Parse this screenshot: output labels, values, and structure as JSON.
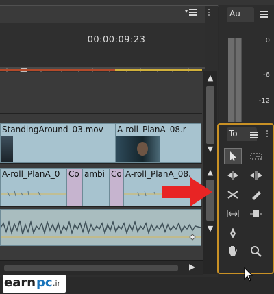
{
  "timeline": {
    "timecode": "00:00:09:23",
    "clips": {
      "video_a": {
        "label": "StandingAround_03.mov"
      },
      "video_b": {
        "label": "A-roll_PlanA_08.r"
      },
      "audio_a": {
        "label": "A-roll_PlanA_0"
      },
      "audio_a_fx": {
        "label": "Co"
      },
      "audio_b": {
        "label": "ambi"
      },
      "audio_b_fx": {
        "label": "Co"
      },
      "audio_c": {
        "label": "A-roll_PlanA_08."
      }
    }
  },
  "audio_panel": {
    "tab_label": "Au",
    "db_labels": [
      "0",
      "-6",
      "-12"
    ]
  },
  "tools_panel": {
    "tab_label": "To",
    "tools": [
      {
        "name": "selection-tool",
        "icon": "arrow-pointer-icon"
      },
      {
        "name": "track-select-tool",
        "icon": "dashed-arrow-icon"
      },
      {
        "name": "ripple-edit-tool",
        "icon": "ripple-edit-icon"
      },
      {
        "name": "rolling-edit-tool",
        "icon": "rolling-edit-icon"
      },
      {
        "name": "rate-stretch-tool",
        "icon": "rate-stretch-icon"
      },
      {
        "name": "razor-tool",
        "icon": "razor-icon"
      },
      {
        "name": "slip-tool",
        "icon": "slip-icon"
      },
      {
        "name": "slide-tool",
        "icon": "slide-icon"
      },
      {
        "name": "pen-tool",
        "icon": "pen-icon"
      },
      {
        "name": "hand-tool",
        "icon": "hand-icon"
      },
      {
        "name": "zoom-tool",
        "icon": "magnifier-icon"
      }
    ]
  },
  "watermark": {
    "text_main": "earn",
    "text_mid": "pc",
    "text_suffix": ".ir"
  },
  "colors": {
    "accent_highlight": "#c99125",
    "clip_blue": "#a7c3cf",
    "work_bar_red": "#b44a2a",
    "work_bar_yellow": "#d2b13a",
    "arrow_red": "#e82424"
  }
}
